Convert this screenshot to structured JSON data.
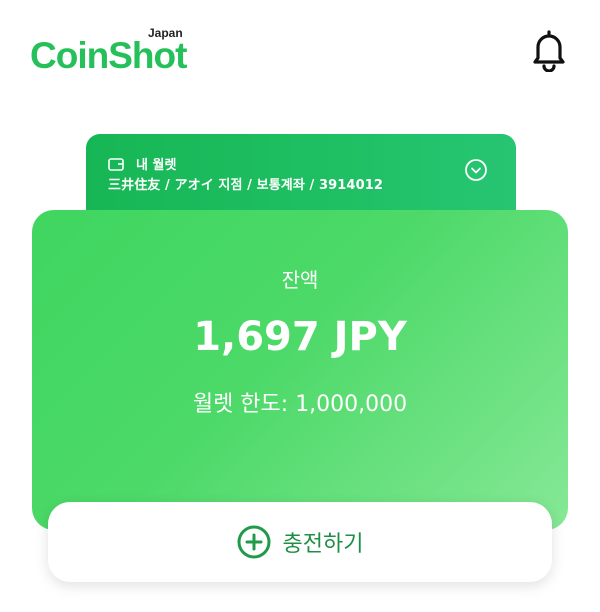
{
  "brand": {
    "name": "CoinShot",
    "region": "Japan",
    "accent": "#25c05a"
  },
  "header": {
    "notification_icon": "bell-icon"
  },
  "wallet": {
    "title": "내 월렛",
    "account": "三井住友 / アオイ 지점 / 보통계좌 / 3914012",
    "icon": "wallet-icon",
    "toggle_icon": "chevron-down-circle-icon"
  },
  "balance": {
    "label": "잔액",
    "amount": "1,697 JPY",
    "limit_label": "월렛 한도: ",
    "limit_value": "1,000,000"
  },
  "actions": {
    "charge_label": "충전하기",
    "charge_icon": "plus-circle-icon"
  }
}
